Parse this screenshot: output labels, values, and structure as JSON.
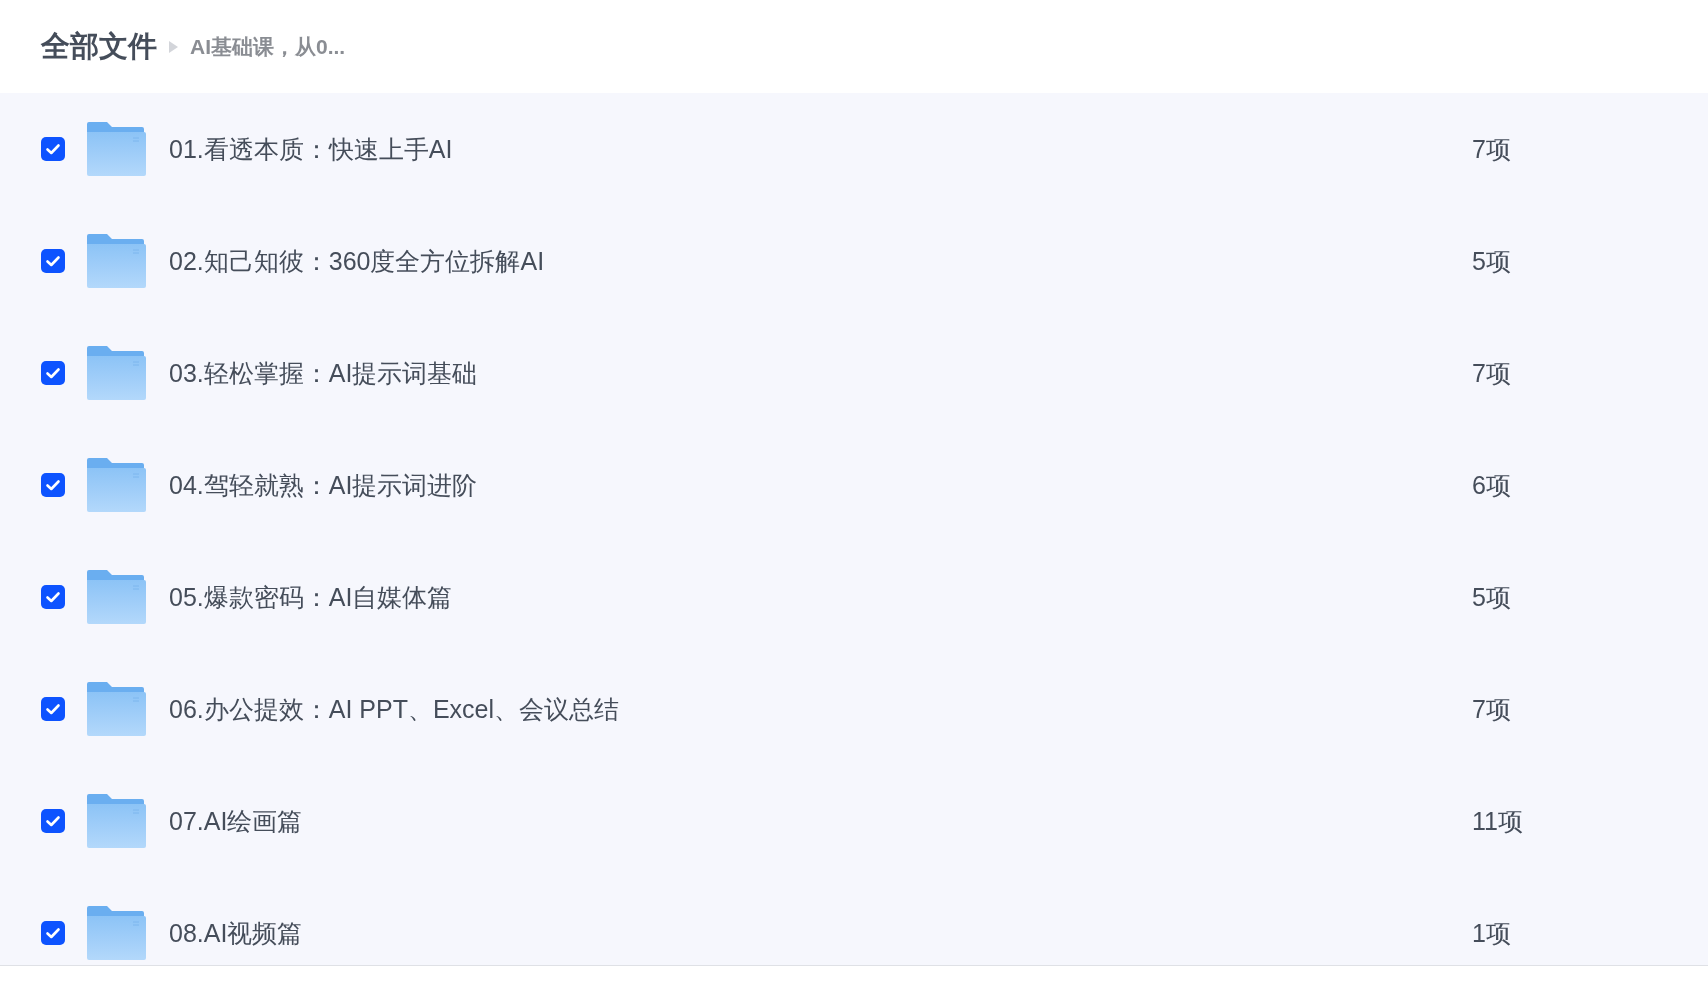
{
  "breadcrumb": {
    "root": "全部文件",
    "current": "AI基础课，从0..."
  },
  "folders": [
    {
      "name": "01.看透本质：快速上手AI",
      "count": "7项",
      "checked": true
    },
    {
      "name": "02.知己知彼：360度全方位拆解AI",
      "count": "5项",
      "checked": true
    },
    {
      "name": "03.轻松掌握：AI提示词基础",
      "count": "7项",
      "checked": true
    },
    {
      "name": "04.驾轻就熟：AI提示词进阶",
      "count": "6项",
      "checked": true
    },
    {
      "name": "05.爆款密码：AI自媒体篇",
      "count": "5项",
      "checked": true
    },
    {
      "name": "06.办公提效：AI PPT、Excel、会议总结",
      "count": "7项",
      "checked": true
    },
    {
      "name": "07.AI绘画篇",
      "count": "11项",
      "checked": true
    },
    {
      "name": "08.AI视频篇",
      "count": "1项",
      "checked": true
    }
  ]
}
